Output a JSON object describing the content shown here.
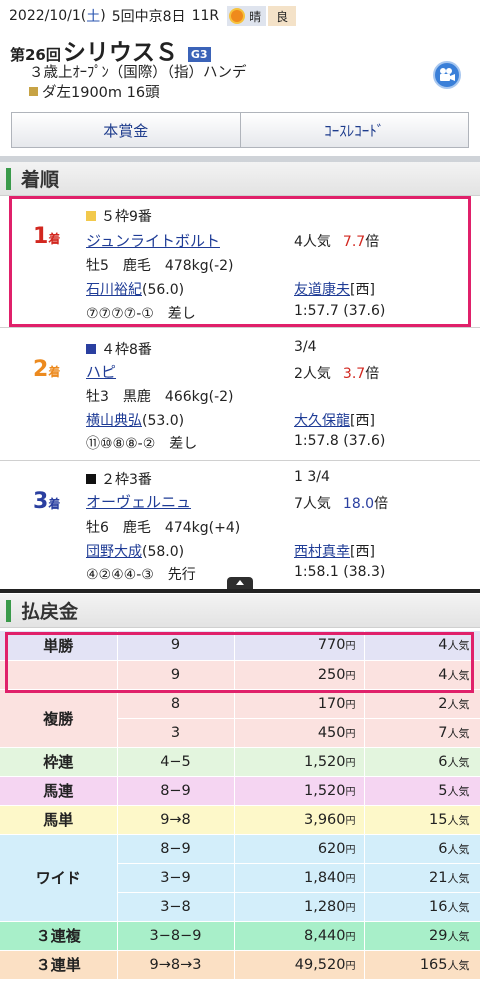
{
  "header": {
    "date": "2022/10/1",
    "dow_open": "(",
    "dow": "土",
    "dow_close": ")",
    "meeting": "5回中京8日",
    "race_no": "11R",
    "weather": "晴",
    "track_condition": "良",
    "race_number_label": "第26回",
    "race_name": "シリウスＳ",
    "grade": "G3",
    "conditions": "３歳上ｵｰﾌﾟﾝ（国際）（指）ハンデ",
    "course": "ダ左1900m 16頭"
  },
  "tabs": [
    "本賞金",
    "ｺｰｽﾚｺｰﾄﾞ"
  ],
  "results_title": "着順",
  "results": [
    {
      "rank": "1",
      "rank_suffix": "着",
      "gate_color": "#f2c94c",
      "gate": "５枠9番",
      "margin": "",
      "horse": "ジュンライトボルト",
      "popularity": "4人気",
      "odds": "7.7",
      "odds_suffix": "倍",
      "sex_age_coat": "牡5　鹿毛　478kg(-2)",
      "jockey": "石川裕紀",
      "weight": "(56.0)",
      "trainer": "友道康夫",
      "trainer_region": "[西]",
      "passing": "⑦⑦⑦⑦-①　差し",
      "time": "1:57.7 (37.6)"
    },
    {
      "rank": "2",
      "rank_suffix": "着",
      "gate_color": "#2a3fa0",
      "gate": "４枠8番",
      "margin": "3/4",
      "horse": "ハピ",
      "popularity": "2人気",
      "odds": "3.7",
      "odds_suffix": "倍",
      "sex_age_coat": "牡3　黒鹿　466kg(-2)",
      "jockey": "横山典弘",
      "weight": "(53.0)",
      "trainer": "大久保龍",
      "trainer_region": "[西]",
      "passing": "⑪⑩⑧⑧-②　差し",
      "time": "1:57.8 (37.6)"
    },
    {
      "rank": "3",
      "rank_suffix": "着",
      "gate_color": "#111111",
      "gate": "２枠3番",
      "margin": "1 3/4",
      "horse": "オーヴェルニュ",
      "popularity": "7人気",
      "odds": "18.0",
      "odds_suffix": "倍",
      "sex_age_coat": "牡6　鹿毛　474kg(+4)",
      "jockey": "団野大成",
      "weight": "(58.0)",
      "trainer": "西村真幸",
      "trainer_region": "[西]",
      "passing": "④②④④-③　先行",
      "time": "1:58.1 (38.3)"
    }
  ],
  "payout_title": "払戻金",
  "yen_unit": "円",
  "pop_unit": "人気",
  "payouts": [
    {
      "type": "単勝",
      "combo": "9",
      "yen": "770",
      "pop": "4",
      "color": "#e3e3f5"
    },
    {
      "type": "",
      "combo": "9",
      "yen": "250",
      "pop": "4",
      "color": "#fbe2e0"
    },
    {
      "type": "複勝",
      "combo": "8",
      "yen": "170",
      "pop": "2",
      "color": "#fbe2e0"
    },
    {
      "type": "",
      "combo": "3",
      "yen": "450",
      "pop": "7",
      "color": "#fbe2e0"
    },
    {
      "type": "枠連",
      "combo": "4−5",
      "yen": "1,520",
      "pop": "6",
      "color": "#e3f5de"
    },
    {
      "type": "馬連",
      "combo": "8−9",
      "yen": "1,520",
      "pop": "5",
      "color": "#f5d5f2"
    },
    {
      "type": "馬単",
      "combo": "9→8",
      "yen": "3,960",
      "pop": "15",
      "color": "#fdf8c9"
    },
    {
      "type": "",
      "combo": "8−9",
      "yen": "620",
      "pop": "6",
      "color": "#d3eefa"
    },
    {
      "type": "ワイド",
      "combo": "3−9",
      "yen": "1,840",
      "pop": "21",
      "color": "#d3eefa"
    },
    {
      "type": "",
      "combo": "3−8",
      "yen": "1,280",
      "pop": "16",
      "color": "#d3eefa"
    },
    {
      "type": "３連複",
      "combo": "3−8−9",
      "yen": "8,440",
      "pop": "29",
      "color": "#a8efc9"
    },
    {
      "type": "３連単",
      "combo": "9→8→3",
      "yen": "49,520",
      "pop": "165",
      "color": "#fbe0c4"
    }
  ]
}
